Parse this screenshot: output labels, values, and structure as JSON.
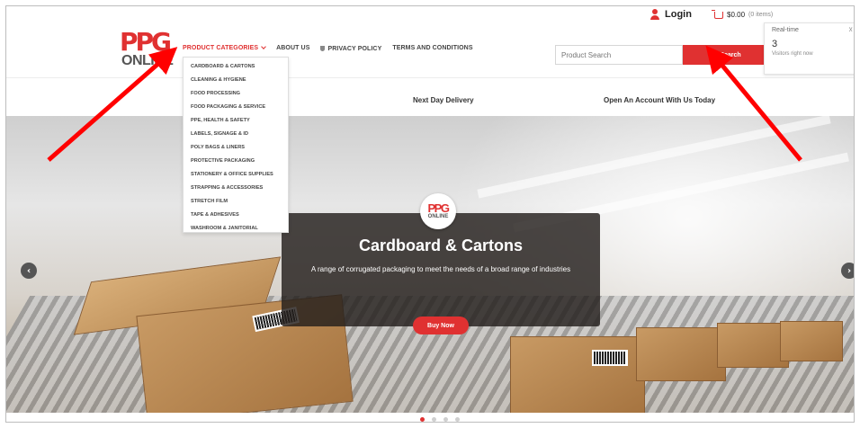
{
  "topbar": {
    "login_label": "Login",
    "cart_amount": "$0.00",
    "cart_count": "(0 items)"
  },
  "realtime": {
    "title": "Real-time",
    "close": "☓",
    "visitors": "3",
    "subtitle": "Visitors right now"
  },
  "logo": {
    "top": "PPG",
    "sub": "ONLINE"
  },
  "nav": {
    "items": [
      {
        "label": "PRODUCT CATEGORIES"
      },
      {
        "label": "ABOUT US"
      },
      {
        "label": "PRIVACY POLICY"
      },
      {
        "label": "TERMS AND CONDITIONS"
      }
    ]
  },
  "search": {
    "placeholder": "Product Search",
    "button_label": "Search"
  },
  "dropdown": {
    "items": [
      "CARDBOARD & CARTONS",
      "CLEANING & HYGIENE",
      "FOOD PROCESSING",
      "FOOD PACKAGING & SERVICE",
      "PPE, HEALTH & SAFETY",
      "LABELS, SIGNAGE & ID",
      "POLY BAGS & LINERS",
      "PROTECTIVE PACKAGING",
      "STATIONERY & OFFICE SUPPLIES",
      "STRAPPING & ACCESSORIES",
      "STRETCH FILM",
      "TAPE & ADHESIVES",
      "WASHROOM & JANITORIAL"
    ]
  },
  "strip": {
    "delivery": "Next Day Delivery",
    "account": "Open An Account With Us Today"
  },
  "hero": {
    "logo_top": "PPG",
    "logo_sub": "ONLINE",
    "title": "Cardboard & Cartons",
    "description": "A range of corrugated packaging to meet the needs of a broad range of industries",
    "cta_label": "Buy Now",
    "prev_arrow": "‹",
    "next_arrow": "›"
  },
  "carousel": {
    "slide_count": 4,
    "active_slide": 1
  },
  "colors": {
    "accent": "#e03131",
    "annotation_arrow": "#ff0000"
  }
}
